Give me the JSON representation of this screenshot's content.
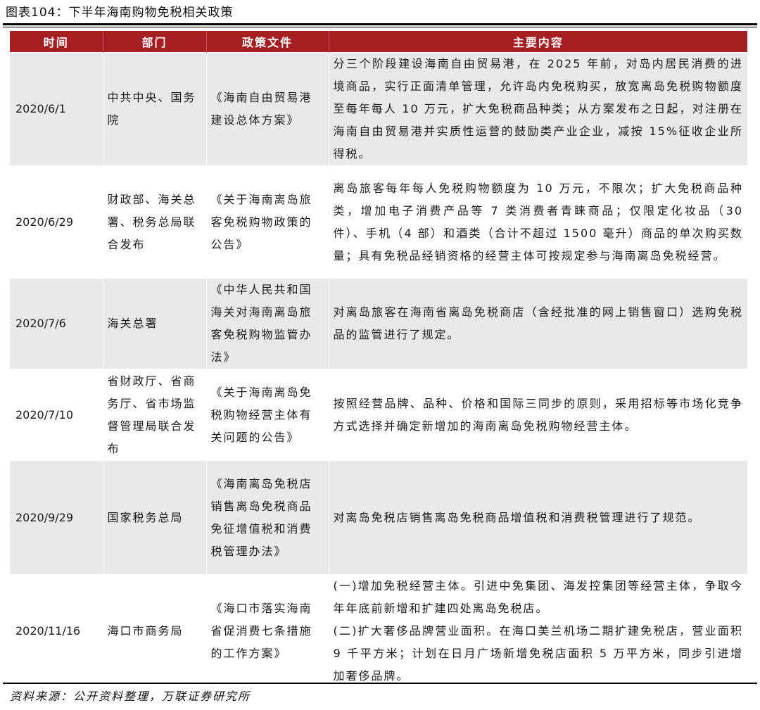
{
  "title": "图表104：下半年海南购物免税相关政策",
  "headers": [
    "时间",
    "部门",
    "政策文件",
    "主要内容"
  ],
  "rows": [
    {
      "date": "2020/6/1",
      "dept": "中共中央、国务院",
      "doc": "《海南自由贸易港建设总体方案》",
      "content": "分三个阶段建设海南自由贸易港，在 2025 年前，对岛内居民消费的进境商品，实行正面清单管理，允许岛内免税购买，放宽离岛免税购物额度至每年每人 10 万元，扩大免税商品种类；从方案发布之日起，对注册在海南自由贸易港并实质性运营的鼓励类产业企业，减按 15%征收企业所得税。"
    },
    {
      "date": "2020/6/29",
      "dept": "财政部、海关总署、税务总局联合发布",
      "doc": "《关于海南离岛旅客免税购物政策的公告》",
      "content": "离岛旅客每年每人免税购物额度为 10 万元，不限次；扩大免税商品种类，增加电子消费产品等 7 类消费者青睐商品；仅限定化妆品（30 件）、手机（4 部）和酒类（合计不超过 1500 毫升）商品的单次购买数量；具有免税品经销资格的经营主体可按规定参与海南离岛免税经营。"
    },
    {
      "date": "2020/7/6",
      "dept": "海关总署",
      "doc": "《中华人民共和国海关对海南离岛旅客免税购物监管办法》",
      "content": "对离岛旅客在海南省离岛免税商店（含经批准的网上销售窗口）选购免税品的监管进行了规定。"
    },
    {
      "date": "2020/7/10",
      "dept": "省财政厅、省商务厅、省市场监督管理局联合发布",
      "doc": "《关于海南离岛免税购物经营主体有关问题的公告》",
      "content": "按照经营品牌、品种、价格和国际三同步的原则，采用招标等市场化竞争方式选择并确定新增加的海南离岛免税购物经营主体。"
    },
    {
      "date": "2020/9/29",
      "dept": "国家税务总局",
      "doc": "《海南离岛免税店销售离岛免税商品免征增值税和消费税管理办法》",
      "content": "对离岛免税店销售离岛免税商品增值税和消费税管理进行了规范。"
    },
    {
      "date": "2020/11/16",
      "dept": "海口市商务局",
      "doc": "《海口市落实海南省促消费七条措施的工作方案》",
      "content_lines": [
        "(一)增加免税经营主体。引进中免集团、海发控集团等经营主体，争取今年年底前新增和扩建四处离岛免税店。",
        "(二)扩大奢侈品牌营业面积。在海口美兰机场二期扩建免税店，营业面积 9 千平方米；计划在日月广场新增免税店面积 5 万平方米，同步引进增加奢侈品牌。"
      ]
    }
  ],
  "source": "资料来源：公开资料整理，万联证券研究所",
  "colors": {
    "header_bg": "#a51e22",
    "header_text": "#ffffff",
    "stripe_bg": "#e9e9e9"
  }
}
